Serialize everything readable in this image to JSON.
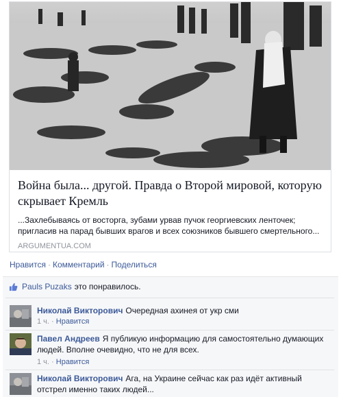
{
  "link_card": {
    "title": "Война была... другой. Правда о Второй мировой, которую скрывает Кремль",
    "description": "...Захлебываясь от восторга, зубами урвав пучок георгиевских ленточек; пригласив на парад бывших врагов и всех союзников бывшего смертельного...",
    "domain": "ARGUMENTUA.COM"
  },
  "actions": {
    "like": "Нравится",
    "comment": "Комментарий",
    "share": "Поделиться",
    "separator": "·"
  },
  "likes": {
    "liker": "Pauls Puzaks",
    "suffix": "это понравилось."
  },
  "comments": [
    {
      "author": "Николай Викторович",
      "text": "Очередная ахинея от укр сми",
      "time": "1 ч.",
      "like_label": "Нравится",
      "dot": "·"
    },
    {
      "author": "Павел Андреев",
      "text": "Я публикую информацию для самостоятельно думающих людей. Вполне очевидно, что не для всех.",
      "time": "1 ч.",
      "like_label": "Нравится",
      "dot": "·"
    },
    {
      "author": "Николай Викторович",
      "text": "Ага, на Украине сейчас как раз идёт активный отстрел именно таких людей...",
      "time": "",
      "like_label": "",
      "dot": ""
    }
  ],
  "colors": {
    "link_blue": "#3b5998",
    "meta_gray": "#90949c",
    "ufi_background": "#f6f7f9"
  },
  "icons": {
    "like": "thumbs-up-icon"
  }
}
